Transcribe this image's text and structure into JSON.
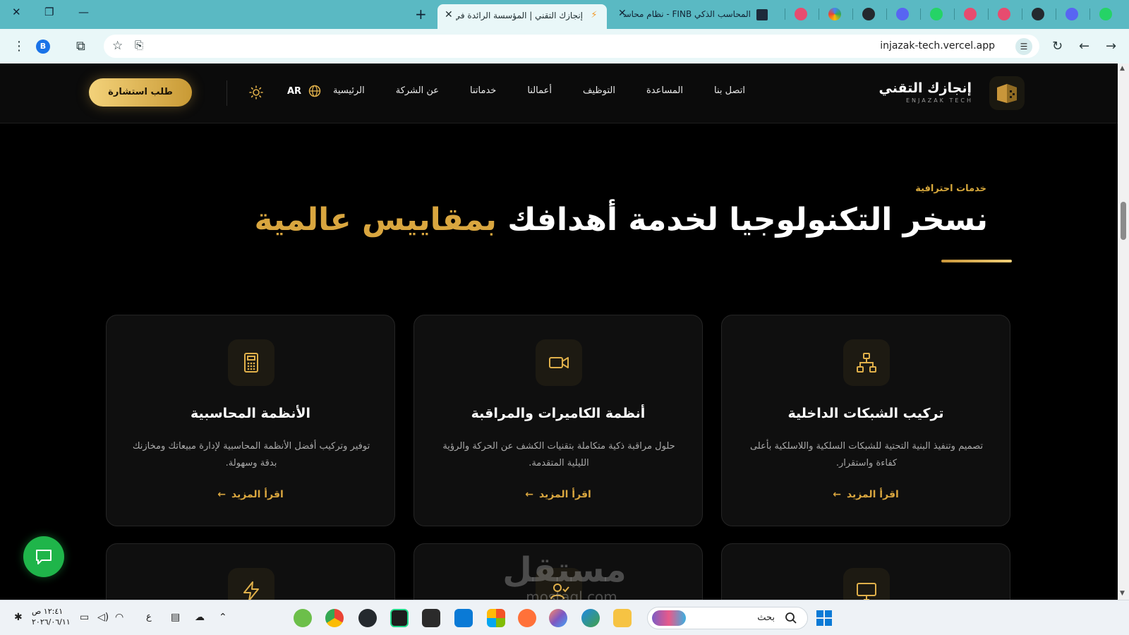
{
  "browser": {
    "active_tab_title": "إنجازك التقني | المؤسسة الرائدة في",
    "second_tab_title": "المحاسب الذكي FINB - نظام محاسبي",
    "url": "injazak-tech.vercel.app",
    "profile_initial": "B"
  },
  "site": {
    "logo_ar": "إنجازك التقني",
    "logo_en": "ENJAZAK TECH",
    "nav": [
      "الرئيسية",
      "عن الشركة",
      "خدماتنا",
      "أعمالنا",
      "التوظيف",
      "المساعدة",
      "اتصل بنا"
    ],
    "lang": "AR",
    "cta": "طلب استشارة",
    "eyebrow": "خدمات احترافية",
    "headline_white": "نسخر التكنولوجيا لخدمة أهدافك",
    "headline_gold": "بمقاييس عالمية",
    "read_more": "اقرأ المزيد",
    "cards": [
      {
        "title": "تركيب الشبكات الداخلية",
        "desc": "تصميم وتنفيذ البنية التحتية للشبكات السلكية واللاسلكية بأعلى كفاءة واستقرار.",
        "icon": "network-icon"
      },
      {
        "title": "أنظمة الكاميرات والمراقبة",
        "desc": "حلول مراقبة ذكية متكاملة بتقنيات الكشف عن الحركة والرؤية الليلية المتقدمة.",
        "icon": "camera-icon"
      },
      {
        "title": "الأنظمة المحاسبية",
        "desc": "توفير وتركيب أفضل الأنظمة المحاسبية لإدارة مبيعاتك ومخازنك بدقة وسهولة.",
        "icon": "calculator-icon"
      }
    ],
    "watermark": "مستقل",
    "watermark_sub": "mostaql.com"
  },
  "taskbar": {
    "time": "١٢:٤١ ص",
    "date": "٢٠٢٦/٠٦/١١",
    "lang_indicator": "ع",
    "search_placeholder": "بحث"
  },
  "colors": {
    "gold": "#d9a63f",
    "tab_bar": "#5ab9c3",
    "chat_green": "#1fb54a"
  }
}
